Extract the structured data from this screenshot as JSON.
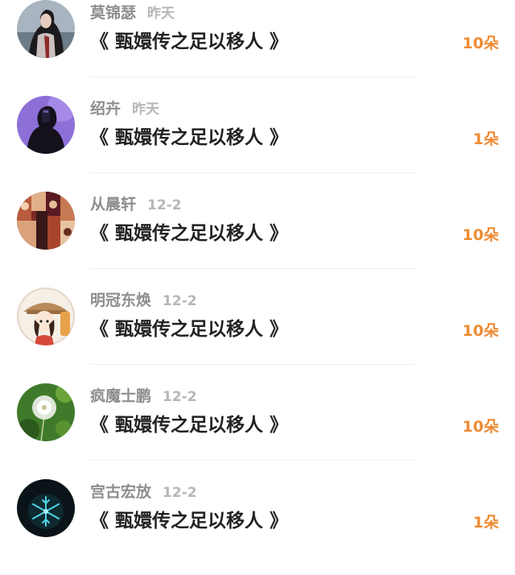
{
  "accent_color": "#f08a32",
  "items": [
    {
      "name": "莫锦瑟",
      "date": "昨天",
      "title": "《 甄嬛传之足以移人 》",
      "count": "10朵",
      "avatar_icon": "girl-portrait-avatar-icon"
    },
    {
      "name": "绍卉",
      "date": "昨天",
      "title": "《 甄嬛传之足以移人 》",
      "count": "1朵",
      "avatar_icon": "mirror-selfie-avatar-icon"
    },
    {
      "name": "从晨轩",
      "date": "12-2",
      "title": "《 甄嬛传之足以移人 》",
      "count": "10朵",
      "avatar_icon": "collage-avatar-icon"
    },
    {
      "name": "明冠东焕",
      "date": "12-2",
      "title": "《 甄嬛传之足以移人 》",
      "count": "10朵",
      "avatar_icon": "cartoon-girl-avatar-icon"
    },
    {
      "name": "疯魔士鹏",
      "date": "12-2",
      "title": "《 甄嬛传之足以移人 》",
      "count": "10朵",
      "avatar_icon": "dandelion-avatar-icon"
    },
    {
      "name": "宫古宏放",
      "date": "12-2",
      "title": "《 甄嬛传之足以移人 》",
      "count": "1朵",
      "avatar_icon": "snowflake-avatar-icon"
    }
  ]
}
